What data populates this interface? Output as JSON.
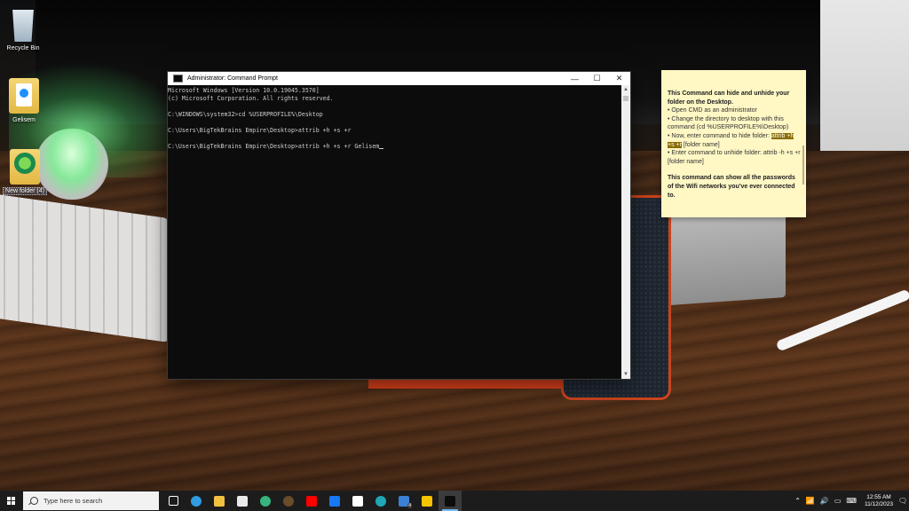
{
  "desktop": {
    "icons": [
      {
        "label": "Recycle Bin"
      },
      {
        "label": "Gelisem"
      },
      {
        "label": "New folder (4)"
      }
    ]
  },
  "cmd": {
    "title": "Administrator: Command Prompt",
    "lines": [
      "Microsoft Windows [Version 10.0.19045.3570]",
      "(c) Microsoft Corporation. All rights reserved.",
      "",
      "C:\\WINDOWS\\system32>cd %USERPROFILE%\\Desktop",
      "",
      "C:\\Users\\BigTekBrains Empire\\Desktop>attrib +h +s +r",
      "",
      "C:\\Users\\BigTekBrains Empire\\Desktop>attrib +h +s +r Gelisem"
    ],
    "controls": {
      "minimize": "—",
      "maximize": "☐",
      "close": "✕"
    }
  },
  "note": {
    "title": "This Command can hide and unhide your folder on the Desktop.",
    "items": [
      "Open CMD as an administrator",
      "Change the directory to desktop with this command (cd %USERPROFILE%\\Desktop)",
      "Enter command to unhide folder: attrib -h +s +r [folder name]"
    ],
    "hide_prefix": "Now, enter command to hide folder: ",
    "hide_highlight": "attrib +h +s +r",
    "hide_suffix": " [folder name]",
    "footer": "This command can show all the passwords of the Wifi networks you've ever connected to.",
    "highlight_color": "#8a6d00"
  },
  "taskbar": {
    "search_placeholder": "Type here to search",
    "apps": [
      {
        "icon": "task-view-icon",
        "color": "#ffffff"
      },
      {
        "icon": "edge-icon",
        "color": "#2f9de0"
      },
      {
        "icon": "file-explorer-icon",
        "color": "#f0c040"
      },
      {
        "icon": "store-icon",
        "color": "#e9e9e9"
      },
      {
        "icon": "edge-dev-icon",
        "color": "#36b37e"
      },
      {
        "icon": "hat-icon",
        "color": "#6b4c2a"
      },
      {
        "icon": "youtube-icon",
        "color": "#ff0000"
      },
      {
        "icon": "facebook-icon",
        "color": "#1877f2"
      },
      {
        "icon": "wikipedia-icon",
        "color": "#ffffff"
      },
      {
        "icon": "edge-icon-2",
        "color": "#1fa7b8"
      },
      {
        "icon": "mail-icon",
        "color": "#3a82d6",
        "badge": "4"
      },
      {
        "icon": "sticky-notes-icon",
        "color": "#f6c400"
      },
      {
        "icon": "command-prompt-icon",
        "color": "#0c0c0c",
        "active": true
      }
    ],
    "tray": {
      "time": "12:55 AM",
      "date": "11/12/2023"
    }
  }
}
